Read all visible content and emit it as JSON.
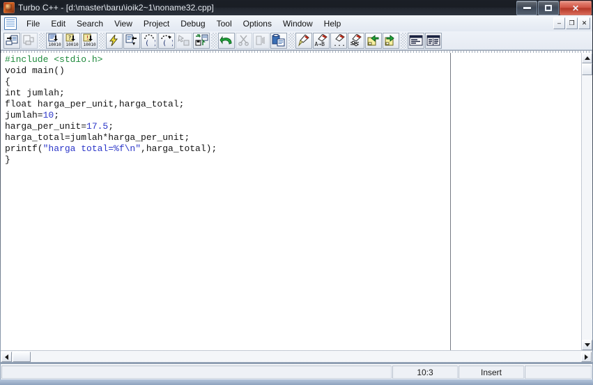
{
  "window": {
    "title": "Turbo C++ - [d:\\master\\baru\\ioik2~1\\noname32.cpp]",
    "app_icon": "turbo-cpp-icon",
    "controls": {
      "minimize": "minimize-icon",
      "maximize": "maximize-icon",
      "close": "✕"
    }
  },
  "menubar": {
    "doc_icon": "document-icon",
    "items": [
      {
        "label": "File"
      },
      {
        "label": "Edit"
      },
      {
        "label": "Search"
      },
      {
        "label": "View"
      },
      {
        "label": "Project"
      },
      {
        "label": "Debug"
      },
      {
        "label": "Tool"
      },
      {
        "label": "Options"
      },
      {
        "label": "Window"
      },
      {
        "label": "Help"
      }
    ],
    "mdi_controls": {
      "minimize": "–",
      "restore": "❐",
      "close": "✕"
    }
  },
  "toolbar": {
    "groups": [
      {
        "buttons": [
          {
            "name": "open-file-icon",
            "disabled": false
          },
          {
            "name": "save-file-icon",
            "disabled": true
          }
        ]
      },
      {
        "buttons": [
          {
            "name": "compile-icon",
            "disabled": false
          },
          {
            "name": "make-icon",
            "disabled": false
          },
          {
            "name": "build-all-icon",
            "disabled": false
          }
        ]
      },
      {
        "buttons": [
          {
            "name": "run-icon",
            "disabled": false
          },
          {
            "name": "step-over-icon",
            "disabled": false
          },
          {
            "name": "trace-into-icon",
            "disabled": false
          },
          {
            "name": "step-out-icon",
            "disabled": false
          },
          {
            "name": "goto-cursor-icon",
            "disabled": true
          },
          {
            "name": "toggle-breakpoint-icon",
            "disabled": false
          }
        ]
      },
      {
        "buttons": [
          {
            "name": "undo-icon",
            "disabled": false
          },
          {
            "name": "cut-icon",
            "disabled": true
          },
          {
            "name": "copy-icon",
            "disabled": true
          },
          {
            "name": "paste-icon",
            "disabled": false
          }
        ]
      },
      {
        "buttons": [
          {
            "name": "find-icon",
            "disabled": false
          },
          {
            "name": "replace-icon",
            "disabled": false
          },
          {
            "name": "find-next-icon",
            "disabled": false
          },
          {
            "name": "find-options-icon",
            "disabled": false
          },
          {
            "name": "previous-bookmark-icon",
            "disabled": false
          },
          {
            "name": "next-bookmark-icon",
            "disabled": false
          }
        ]
      },
      {
        "buttons": [
          {
            "name": "message-window-icon",
            "disabled": false
          },
          {
            "name": "project-window-icon",
            "disabled": false
          }
        ]
      }
    ]
  },
  "editor": {
    "lines": [
      {
        "segments": [
          {
            "text": "#include <stdio.h>",
            "type": "preprocessor"
          }
        ]
      },
      {
        "segments": [
          {
            "text": "void main()",
            "type": "plain"
          }
        ]
      },
      {
        "segments": [
          {
            "text": "{",
            "type": "plain"
          }
        ]
      },
      {
        "segments": [
          {
            "text": "int jumlah;",
            "type": "plain"
          }
        ]
      },
      {
        "segments": [
          {
            "text": "float harga_per_unit,harga_total;",
            "type": "plain"
          }
        ]
      },
      {
        "segments": [
          {
            "text": "jumlah=",
            "type": "plain"
          },
          {
            "text": "10",
            "type": "number"
          },
          {
            "text": ";",
            "type": "plain"
          }
        ]
      },
      {
        "segments": [
          {
            "text": "harga_per_unit=",
            "type": "plain"
          },
          {
            "text": "17.5",
            "type": "number"
          },
          {
            "text": ";",
            "type": "plain"
          }
        ]
      },
      {
        "segments": [
          {
            "text": "harga_total=jumlah*harga_per_unit;",
            "type": "plain"
          }
        ]
      },
      {
        "segments": [
          {
            "text": "printf(",
            "type": "plain"
          },
          {
            "text": "\"harga total=%f\\n\"",
            "type": "string"
          },
          {
            "text": ",harga_total);",
            "type": "plain"
          }
        ]
      },
      {
        "segments": [
          {
            "text": "}",
            "type": "plain"
          }
        ]
      }
    ],
    "colors": {
      "preprocessor": "#1f8a3c",
      "string": "#2a35c8",
      "number": "#2a35c8",
      "plain": "#141414",
      "background": "#ffffff"
    },
    "margin_guide_column": true
  },
  "scrollbars": {
    "vertical": {
      "up": "scroll-up-arrow",
      "down": "scroll-down-arrow"
    },
    "horizontal": {
      "left": "scroll-left-arrow",
      "right": "scroll-right-arrow"
    }
  },
  "statusbar": {
    "panel_main": "",
    "cursor_position": "10:3",
    "insert_mode": "Insert",
    "panel_extra": ""
  }
}
